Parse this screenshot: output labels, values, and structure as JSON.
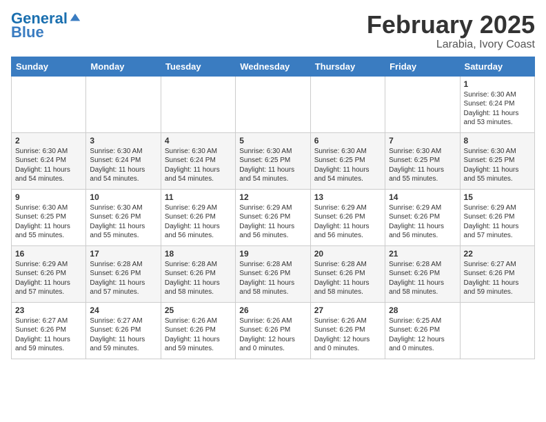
{
  "header": {
    "logo_general": "General",
    "logo_blue": "Blue",
    "month_year": "February 2025",
    "location": "Larabia, Ivory Coast"
  },
  "weekdays": [
    "Sunday",
    "Monday",
    "Tuesday",
    "Wednesday",
    "Thursday",
    "Friday",
    "Saturday"
  ],
  "weeks": [
    [
      {
        "day": "",
        "info": ""
      },
      {
        "day": "",
        "info": ""
      },
      {
        "day": "",
        "info": ""
      },
      {
        "day": "",
        "info": ""
      },
      {
        "day": "",
        "info": ""
      },
      {
        "day": "",
        "info": ""
      },
      {
        "day": "1",
        "info": "Sunrise: 6:30 AM\nSunset: 6:24 PM\nDaylight: 11 hours and 53 minutes."
      }
    ],
    [
      {
        "day": "2",
        "info": "Sunrise: 6:30 AM\nSunset: 6:24 PM\nDaylight: 11 hours and 54 minutes."
      },
      {
        "day": "3",
        "info": "Sunrise: 6:30 AM\nSunset: 6:24 PM\nDaylight: 11 hours and 54 minutes."
      },
      {
        "day": "4",
        "info": "Sunrise: 6:30 AM\nSunset: 6:24 PM\nDaylight: 11 hours and 54 minutes."
      },
      {
        "day": "5",
        "info": "Sunrise: 6:30 AM\nSunset: 6:25 PM\nDaylight: 11 hours and 54 minutes."
      },
      {
        "day": "6",
        "info": "Sunrise: 6:30 AM\nSunset: 6:25 PM\nDaylight: 11 hours and 54 minutes."
      },
      {
        "day": "7",
        "info": "Sunrise: 6:30 AM\nSunset: 6:25 PM\nDaylight: 11 hours and 55 minutes."
      },
      {
        "day": "8",
        "info": "Sunrise: 6:30 AM\nSunset: 6:25 PM\nDaylight: 11 hours and 55 minutes."
      }
    ],
    [
      {
        "day": "9",
        "info": "Sunrise: 6:30 AM\nSunset: 6:25 PM\nDaylight: 11 hours and 55 minutes."
      },
      {
        "day": "10",
        "info": "Sunrise: 6:30 AM\nSunset: 6:26 PM\nDaylight: 11 hours and 55 minutes."
      },
      {
        "day": "11",
        "info": "Sunrise: 6:29 AM\nSunset: 6:26 PM\nDaylight: 11 hours and 56 minutes."
      },
      {
        "day": "12",
        "info": "Sunrise: 6:29 AM\nSunset: 6:26 PM\nDaylight: 11 hours and 56 minutes."
      },
      {
        "day": "13",
        "info": "Sunrise: 6:29 AM\nSunset: 6:26 PM\nDaylight: 11 hours and 56 minutes."
      },
      {
        "day": "14",
        "info": "Sunrise: 6:29 AM\nSunset: 6:26 PM\nDaylight: 11 hours and 56 minutes."
      },
      {
        "day": "15",
        "info": "Sunrise: 6:29 AM\nSunset: 6:26 PM\nDaylight: 11 hours and 57 minutes."
      }
    ],
    [
      {
        "day": "16",
        "info": "Sunrise: 6:29 AM\nSunset: 6:26 PM\nDaylight: 11 hours and 57 minutes."
      },
      {
        "day": "17",
        "info": "Sunrise: 6:28 AM\nSunset: 6:26 PM\nDaylight: 11 hours and 57 minutes."
      },
      {
        "day": "18",
        "info": "Sunrise: 6:28 AM\nSunset: 6:26 PM\nDaylight: 11 hours and 58 minutes."
      },
      {
        "day": "19",
        "info": "Sunrise: 6:28 AM\nSunset: 6:26 PM\nDaylight: 11 hours and 58 minutes."
      },
      {
        "day": "20",
        "info": "Sunrise: 6:28 AM\nSunset: 6:26 PM\nDaylight: 11 hours and 58 minutes."
      },
      {
        "day": "21",
        "info": "Sunrise: 6:28 AM\nSunset: 6:26 PM\nDaylight: 11 hours and 58 minutes."
      },
      {
        "day": "22",
        "info": "Sunrise: 6:27 AM\nSunset: 6:26 PM\nDaylight: 11 hours and 59 minutes."
      }
    ],
    [
      {
        "day": "23",
        "info": "Sunrise: 6:27 AM\nSunset: 6:26 PM\nDaylight: 11 hours and 59 minutes."
      },
      {
        "day": "24",
        "info": "Sunrise: 6:27 AM\nSunset: 6:26 PM\nDaylight: 11 hours and 59 minutes."
      },
      {
        "day": "25",
        "info": "Sunrise: 6:26 AM\nSunset: 6:26 PM\nDaylight: 11 hours and 59 minutes."
      },
      {
        "day": "26",
        "info": "Sunrise: 6:26 AM\nSunset: 6:26 PM\nDaylight: 12 hours and 0 minutes."
      },
      {
        "day": "27",
        "info": "Sunrise: 6:26 AM\nSunset: 6:26 PM\nDaylight: 12 hours and 0 minutes."
      },
      {
        "day": "28",
        "info": "Sunrise: 6:25 AM\nSunset: 6:26 PM\nDaylight: 12 hours and 0 minutes."
      },
      {
        "day": "",
        "info": ""
      }
    ]
  ]
}
